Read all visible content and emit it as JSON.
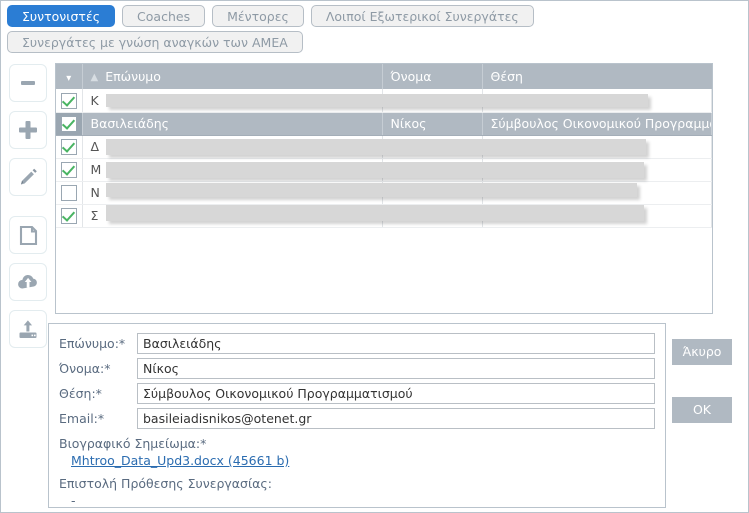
{
  "tabs": {
    "row1": [
      {
        "label": "Συντονιστές",
        "active": true
      },
      {
        "label": "Coaches",
        "active": false
      },
      {
        "label": "Μέντορες",
        "active": false
      },
      {
        "label": "Λοιποί Εξωτερικοί Συνεργάτες",
        "active": false
      }
    ],
    "row2": [
      {
        "label": "Συνεργάτες με γνώση αναγκών των ΑΜΕΑ",
        "active": false
      }
    ]
  },
  "toolbar": {
    "items": [
      {
        "name": "remove-icon",
        "title": "minus"
      },
      {
        "name": "add-icon",
        "title": "plus"
      },
      {
        "name": "edit-icon",
        "title": "pencil"
      },
      {
        "name": "document-icon",
        "title": "page"
      },
      {
        "name": "cloud-upload-icon",
        "title": "cloud upload"
      },
      {
        "name": "drive-upload-icon",
        "title": "upload to server"
      }
    ]
  },
  "table": {
    "header": {
      "check_glyph": "▾",
      "sort_glyph": "▲",
      "columns": [
        "Επώνυμο",
        "Όνομα",
        "Θέση"
      ]
    },
    "rows": [
      {
        "checked": true,
        "selected": false,
        "last": "Κ",
        "first": "",
        "position": "",
        "redacted": true
      },
      {
        "checked": true,
        "selected": true,
        "last": "Βασιλειάδης",
        "first": "Νίκος",
        "position": "Σύμβουλος Οικονομικού Προγραμματισμού",
        "redacted": false
      },
      {
        "checked": true,
        "selected": false,
        "last": "Δ",
        "first": "",
        "position": "",
        "redacted": true
      },
      {
        "checked": true,
        "selected": false,
        "last": "Μ",
        "first": "",
        "position": "",
        "redacted": true
      },
      {
        "checked": false,
        "selected": false,
        "last": "Ν",
        "first": "",
        "position": "",
        "redacted": true
      },
      {
        "checked": true,
        "selected": false,
        "last": "Σ",
        "first": "",
        "position": "",
        "redacted": true
      }
    ]
  },
  "form": {
    "fields": [
      {
        "label": "Επώνυμο:*",
        "value": "Βασιλειάδης"
      },
      {
        "label": "Όνομα:*",
        "value": "Νίκος"
      },
      {
        "label": "Θέση:*",
        "value": "Σύμβουλος Οικονομικού Προγραμματισμού"
      },
      {
        "label": "Email:*",
        "value": "basileiadisnikos@otenet.gr"
      }
    ],
    "cv_caption": "Βιογραφικό Σημείωμα:*",
    "cv_file": "Mhtroo_Data_Upd3.docx (45661 b)",
    "letter_caption": "Επιστολή Πρόθεσης Συνεργασίας:",
    "letter_value": "-"
  },
  "actions": {
    "cancel_label": "Άκυρο",
    "ok_label": "OK"
  },
  "colors": {
    "accent": "#2b7dd4",
    "header_bar": "#b0b9c2",
    "link": "#2b6cb0",
    "check": "#49b463"
  }
}
